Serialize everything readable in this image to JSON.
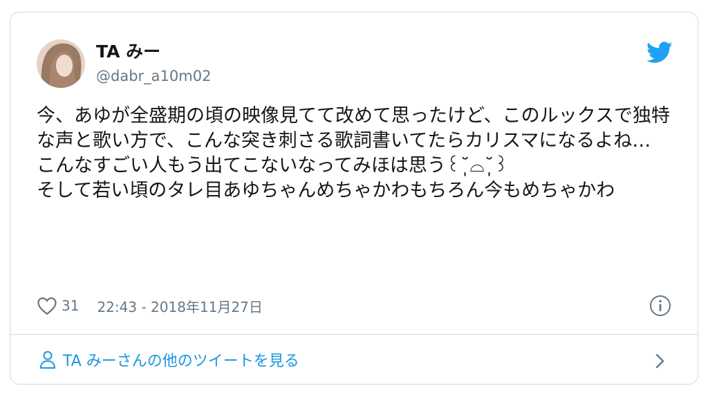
{
  "tweet": {
    "display_name": "TA みー",
    "handle": "@dabr_a10m02",
    "text": "今、あゆが全盛期の頃の映像見てて改めて思ったけど、このルックスで独特な声と歌い方で、こんな突き刺さる歌詞書いてたらカリスマになるよね…\nこんなすごい人もう出てこないなってみほは思う꒰˘̩̩̩⌓˘̩̩̩꒱\nそして若い頃のタレ目あゆちゃんめちゃかわもちろん今もめちゃかわ",
    "like_count": "31",
    "timestamp": "22:43 - 2018年11月27日"
  },
  "footer": {
    "more_tweets_label": "TA みーさんの他のツイートを見る"
  },
  "icons": {
    "brand": "twitter-bird-icon",
    "like": "heart-icon",
    "info": "info-icon",
    "profile": "person-icon",
    "next": "chevron-right-icon"
  },
  "colors": {
    "twitter_blue": "#1da1f2",
    "link_blue": "#1b95e0",
    "text": "#14171a",
    "secondary": "#657786",
    "border": "#d0dbe4"
  }
}
